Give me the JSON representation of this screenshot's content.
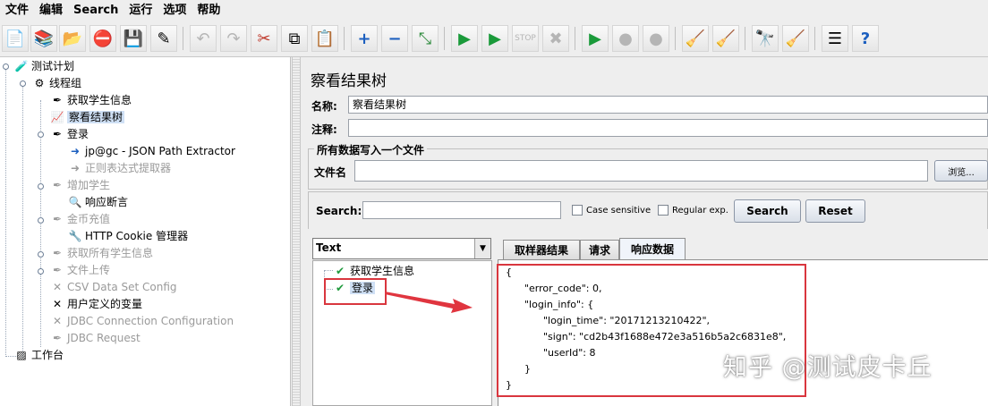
{
  "menu": [
    "文件",
    "编辑",
    "Search",
    "运行",
    "选项",
    "帮助"
  ],
  "toolbar": {
    "icons": [
      "new-icon",
      "templates-icon",
      "open-icon",
      "close-icon",
      "save-icon",
      "save-as-icon",
      "undo-icon",
      "redo-icon",
      "cut-icon",
      "copy-icon",
      "paste-icon",
      "expand-icon",
      "collapse-icon",
      "toggle-icon",
      "start-icon",
      "start-no-pause-icon",
      "stop-icon",
      "shutdown-icon",
      "remote-start-icon",
      "remote-stop-icon",
      "remote-exit-icon",
      "clear-icon",
      "clear-all-icon",
      "search-icon",
      "reset-search-icon",
      "function-helper-icon",
      "help-icon"
    ]
  },
  "tree": {
    "nodes": [
      {
        "label": "测试计划"
      },
      {
        "label": "线程组"
      },
      {
        "label": "获取学生信息"
      },
      {
        "label": "察看结果树"
      },
      {
        "label": "登录"
      },
      {
        "label": "jp@gc - JSON Path Extractor"
      },
      {
        "label": "正则表达式提取器"
      },
      {
        "label": "增加学生"
      },
      {
        "label": "响应断言"
      },
      {
        "label": "金币充值"
      },
      {
        "label": "HTTP Cookie 管理器"
      },
      {
        "label": "获取所有学生信息"
      },
      {
        "label": "文件上传"
      },
      {
        "label": "CSV Data Set Config"
      },
      {
        "label": "用户定义的变量"
      },
      {
        "label": "JDBC Connection Configuration"
      },
      {
        "label": "JDBC Request"
      },
      {
        "label": "工作台"
      }
    ]
  },
  "panel": {
    "title": "察看结果树",
    "name_label": "名称:",
    "name_value": "察看结果树",
    "comment_label": "注释:",
    "comment_value": "",
    "file_group_title": "所有数据写入一个文件",
    "filename_label": "文件名",
    "filename_value": "",
    "browse_label": "浏览...",
    "search_label": "Search:",
    "search_value": "",
    "case_label": "Case sensitive",
    "regex_label": "Regular exp.",
    "search_button": "Search",
    "reset_button": "Reset"
  },
  "results": {
    "renderer": "Text",
    "items": [
      "获取学生信息",
      "登录"
    ]
  },
  "tabs": [
    "取样器结果",
    "请求",
    "响应数据"
  ],
  "response": {
    "lines": [
      "{",
      "      \"error_code\": 0,",
      "      \"login_info\": {",
      "            \"login_time\": \"20171213210422\",",
      "            \"sign\": \"cd2b43f1688e472e3a516b5a2c6831e8\",",
      "            \"userId\": 8",
      "      }",
      "}"
    ]
  },
  "watermark": "知乎 @测试皮卡丘",
  "colors": {
    "highlight": "#d9363e",
    "selection": "#cfe0f5"
  }
}
